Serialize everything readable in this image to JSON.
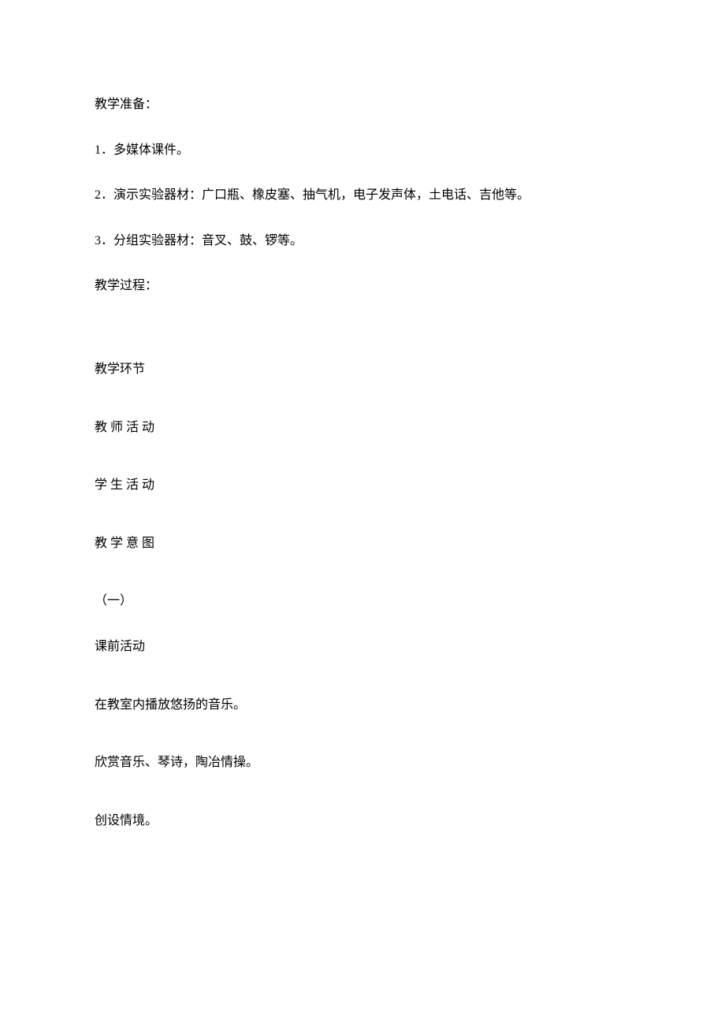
{
  "prep": {
    "title": "教学准备：",
    "item1": "1．多媒体课件。",
    "item2": "2．演示实验器材：广口瓶、橡皮塞、抽气机，电子发声体，土电话、吉他等。",
    "item3": "3．分组实验器材：音叉、鼓、锣等。"
  },
  "process": {
    "title": "教学过程：",
    "section_label": "教学环节",
    "teacher_label": "教 师 活 动",
    "student_label": "学 生 活 动",
    "intent_label": "教 学 意 图",
    "part1_num": "（一）",
    "part1_title": "课前活动",
    "teacher_act": "在教室内播放悠扬的音乐。",
    "student_act": "欣赏音乐、琴诗，陶冶情操。",
    "intent": "创设情境。"
  }
}
